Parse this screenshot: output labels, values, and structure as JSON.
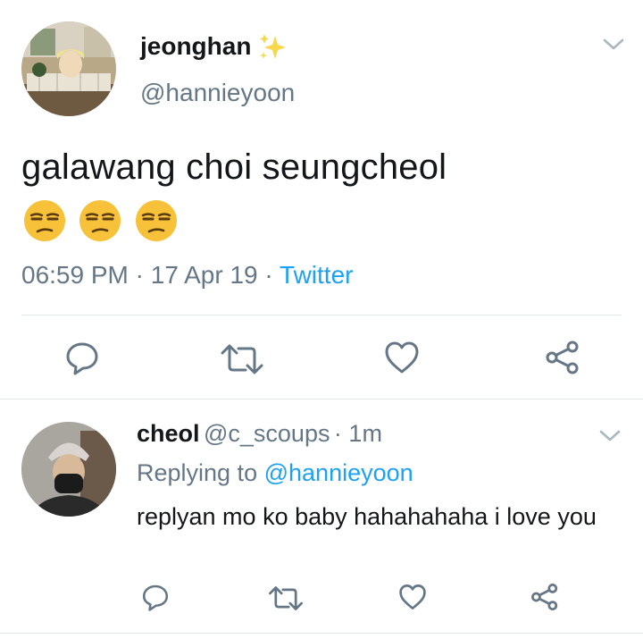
{
  "tweet": {
    "display_name": "jeonghan",
    "name_emoji": "sparkles-icon",
    "handle": "@hannieyoon",
    "text": "galawang choi seungcheol",
    "emojis": [
      "unamused-face-icon",
      "unamused-face-icon",
      "unamused-face-icon"
    ],
    "time": "06:59 PM",
    "date": "17 Apr 19",
    "source": "Twitter",
    "actions": [
      "reply-icon",
      "retweet-icon",
      "like-icon",
      "share-icon"
    ]
  },
  "reply": {
    "display_name": "cheol",
    "handle": "@c_scoups",
    "time_ago": "1m",
    "replying_prefix": "Replying to",
    "replying_to": "@hannieyoon",
    "text": "replyan mo ko baby hahahahaha i love you",
    "actions": [
      "reply-icon",
      "retweet-icon",
      "like-icon",
      "share-icon"
    ]
  },
  "colors": {
    "link": "#1da1f2",
    "secondary": "#657786",
    "divider": "#e1e8ed",
    "icon": "#657786"
  }
}
